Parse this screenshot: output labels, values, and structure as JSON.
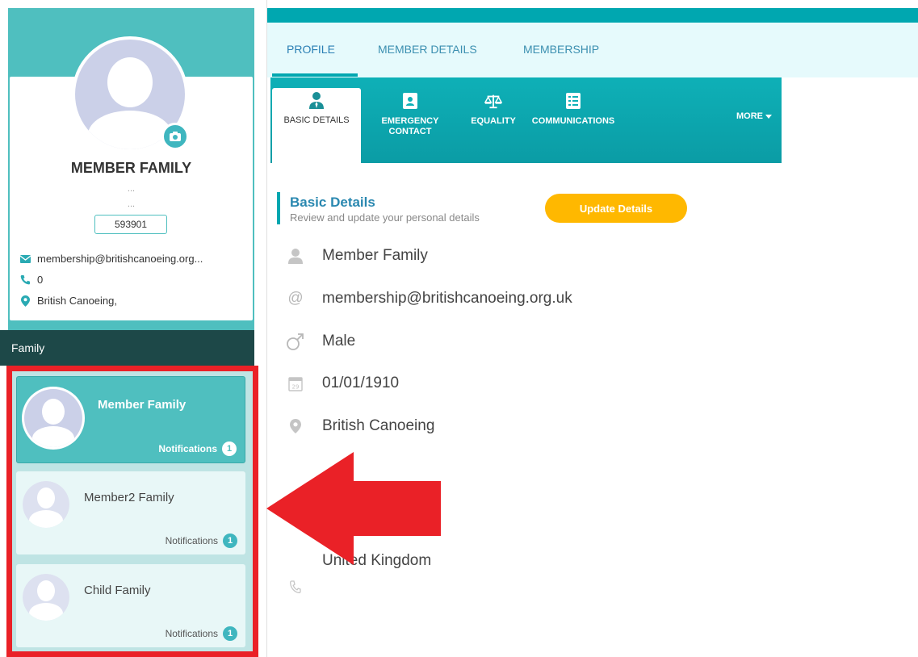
{
  "profile": {
    "name": "MEMBER FAMILY",
    "dots1": "...",
    "dots2": "...",
    "member_id": "593901",
    "email": "membership@britishcanoeing.org...",
    "phone": "0",
    "address": "British Canoeing,"
  },
  "family": {
    "header": "Family",
    "members": [
      {
        "name": "Member Family",
        "notifications_label": "Notifications",
        "count": "1",
        "active": true
      },
      {
        "name": "Member2 Family",
        "notifications_label": "Notifications",
        "count": "1",
        "active": false
      },
      {
        "name": "Child Family",
        "notifications_label": "Notifications",
        "count": "1",
        "active": false
      }
    ]
  },
  "tabs": [
    "PROFILE",
    "MEMBER DETAILS",
    "MEMBERSHIP"
  ],
  "subtabs": [
    {
      "label": "BASIC DETAILS",
      "icon": "user-tie-icon"
    },
    {
      "label": "EMERGENCY CONTACT",
      "icon": "contact-card-icon"
    },
    {
      "label": "EQUALITY",
      "icon": "scales-icon"
    },
    {
      "label": "COMMUNICATIONS",
      "icon": "checklist-icon"
    }
  ],
  "more_label": "MORE",
  "section": {
    "title": "Basic Details",
    "subtitle": "Review and update your personal details",
    "update_button": "Update Details"
  },
  "details": {
    "name": "Member Family",
    "email": "membership@britishcanoeing.org.uk",
    "gender": "Male",
    "dob": "01/01/1910",
    "address": "British Canoeing",
    "country": "United Kingdom",
    "phone": ""
  },
  "colors": {
    "teal": "#4fbfbf",
    "accent": "#00a7b0",
    "dark": "#1d4848",
    "orange": "#ffb800",
    "red": "#ea2127"
  }
}
